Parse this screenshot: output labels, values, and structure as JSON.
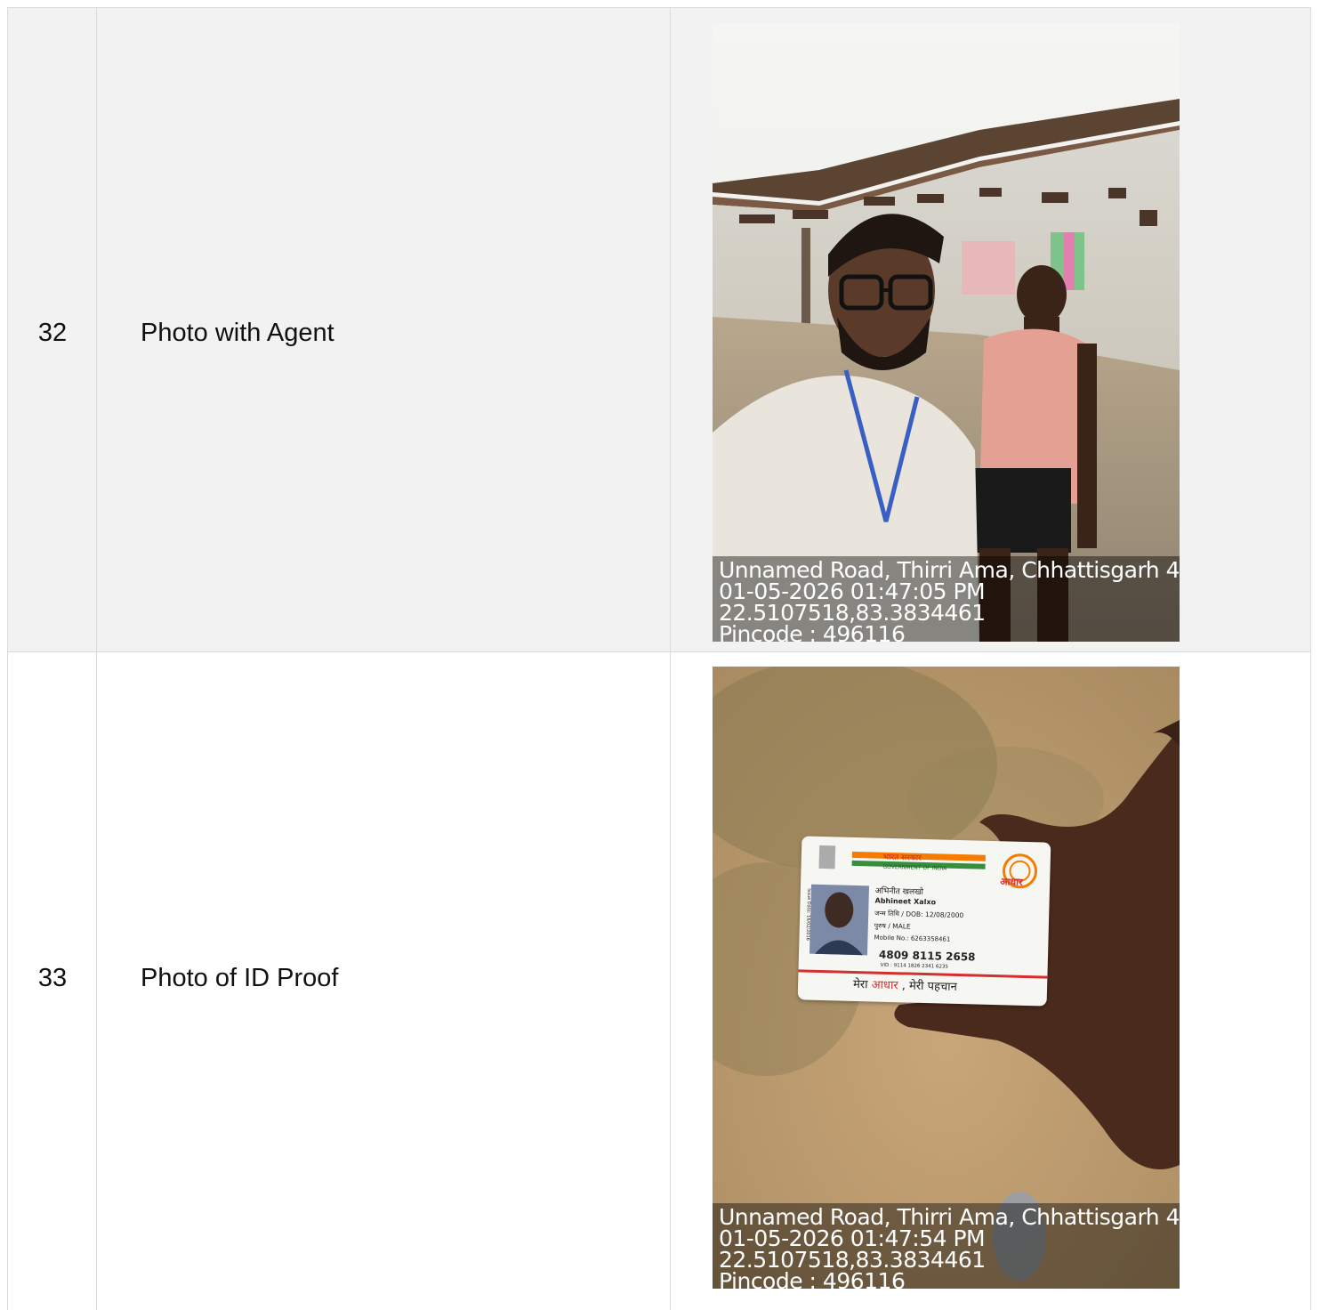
{
  "rows": [
    {
      "number": "32",
      "label": "Photo with Agent",
      "photo": {
        "overlay_lines": [
          "Unnamed Road, Thirri Ama, Chhattisgarh 4",
          "01-05-2026 01:47:05 PM",
          "22.5107518,83.3834461",
          "Pincode : 496116"
        ]
      }
    },
    {
      "number": "33",
      "label": "Photo of ID Proof",
      "photo": {
        "overlay_lines": [
          "Unnamed Road, Thirri Ama, Chhattisgarh 4",
          "01-05-2026 01:47:54 PM",
          "22.5107518,83.3834461",
          "Pincode : 496116"
        ],
        "card": {
          "gov_hindi": "भारत सरकार",
          "gov_english": "GOVERNMENT OF INDIA",
          "logo_text": "आधार",
          "name_hindi": "अभिनीत खलखो",
          "name_english": "Abhineet Xalxo",
          "dob": "जन्म तिथि / DOB: 12/08/2000",
          "gender": "पुरुष / MALE",
          "mobile": "Mobile No.: 6263358461",
          "issue_date": "Issue Date: 16/02/2016",
          "aadhaar_number": "4809 8115 2658",
          "vid": "VID : 9114 1826 2341 6235",
          "tagline_prefix": "मेरा",
          "tagline_highlight": "आधार",
          "tagline_suffix": ", मेरी पहचान"
        }
      }
    }
  ],
  "colors": {
    "row_alt_background": "#f2f2f2",
    "border": "#dcdcdc",
    "aadhaar_red": "#d32f2f",
    "saffron": "#f57c00",
    "green": "#388e3c"
  }
}
